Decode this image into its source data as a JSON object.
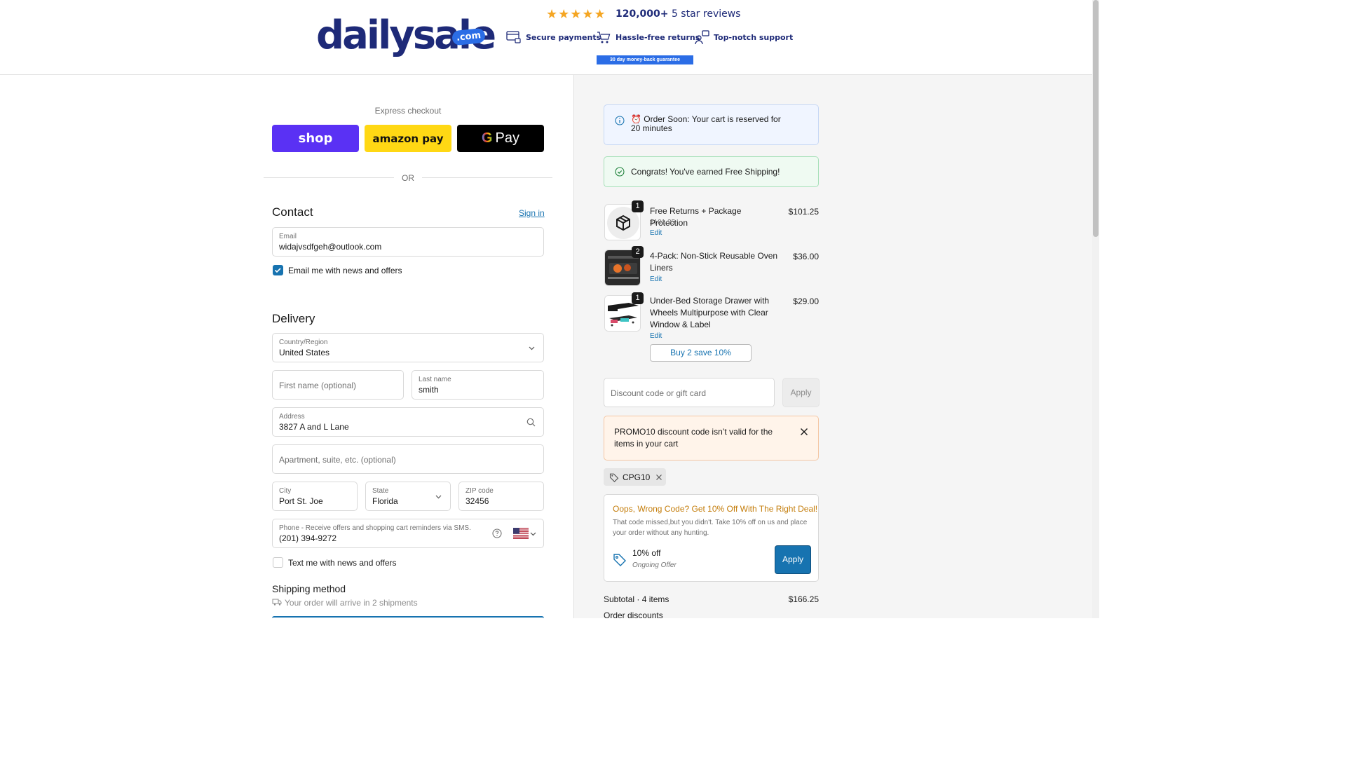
{
  "header": {
    "logo_main": "dailysale",
    "logo_com": ".com",
    "logo_tm": "TM",
    "stars": "★★★★★",
    "reviews_bold": "120,000+",
    "reviews_rest": " 5 star reviews",
    "trust": [
      "Secure payments",
      "Hassle-free returns",
      "Top-notch support"
    ],
    "guarantee": "30 day money-back guarantee",
    "colors": {
      "brand": "#1e2a78",
      "accent": "#2b6de6"
    }
  },
  "express": {
    "label": "Express checkout",
    "shop": "shop",
    "amazon": "amazon pay",
    "gpay_g": "G",
    "gpay": "Pay",
    "or": "OR"
  },
  "contact": {
    "title": "Contact",
    "sign_in": "Sign in",
    "email_label": "Email",
    "email_value": "widajvsdfgeh@outlook.com",
    "news_label": "Email me with news and offers",
    "news_checked": true
  },
  "delivery": {
    "title": "Delivery",
    "country_label": "Country/Region",
    "country_value": "United States",
    "first_name_placeholder": "First name (optional)",
    "last_name_label": "Last name",
    "last_name_value": "smith",
    "address_label": "Address",
    "address_value": "3827 A and L Lane",
    "apt_placeholder": "Apartment, suite, etc. (optional)",
    "city_label": "City",
    "city_value": "Port St. Joe",
    "state_label": "State",
    "state_value": "Florida",
    "zip_label": "ZIP code",
    "zip_value": "32456",
    "phone_label": "Phone - Receive offers and shopping cart reminders via SMS.",
    "phone_value": "(201) 394-9272",
    "sms_label": "Text me with news and offers",
    "sms_checked": false
  },
  "shipping": {
    "title": "Shipping method",
    "note": "Your order will arrive in 2 shipments"
  },
  "notices": {
    "order_soon": "⏰ Order Soon: Your cart is reserved for 20 minutes",
    "free_shipping": "Congrats! You've earned Free Shipping!"
  },
  "cart_items": [
    {
      "qty": "1",
      "name": "Free Returns + Package Protection",
      "sub": "$101.25",
      "edit": "Edit",
      "price": "$101.25"
    },
    {
      "qty": "2",
      "name": "4-Pack: Non-Stick Reusable Oven Liners",
      "sub": "",
      "edit": "Edit",
      "price": "$36.00"
    },
    {
      "qty": "1",
      "name": "Under-Bed Storage Drawer with Wheels Multipurpose with Clear Window & Label",
      "sub": "",
      "edit": "Edit",
      "price": "$29.00"
    }
  ],
  "buy2": "Buy 2 save 10%",
  "discount": {
    "placeholder": "Discount code or gift card",
    "apply": "Apply",
    "error": "PROMO10 discount code isn’t valid for the items in your cart",
    "chip": "CPG10"
  },
  "offer": {
    "title": "Oops, Wrong Code? Get 10% Off With The Right Deal!",
    "desc": "That code missed,but you didn't. Take 10% off on us and place your order without any hunting.",
    "pct": "10% off",
    "ongoing": "Ongoing Offer",
    "apply": "Apply"
  },
  "summary": {
    "subtotal_label": "Subtotal · 4 items",
    "subtotal_value": "$166.25",
    "discounts_label": "Order discounts"
  }
}
